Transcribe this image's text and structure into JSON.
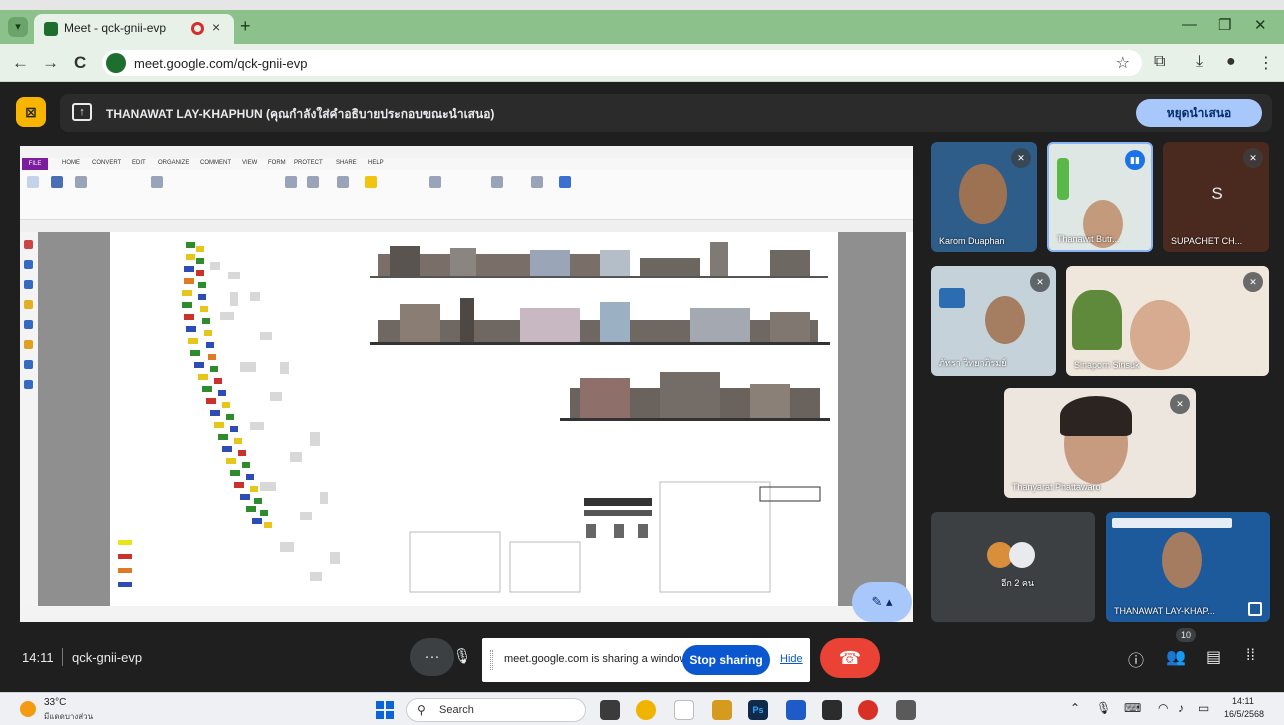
{
  "browser": {
    "tab_title": "Meet - qck-gnii-evp",
    "tab_close": "×",
    "new_tab": "+",
    "url": "meet.google.com/qck-gnii-evp",
    "nav": {
      "back": "←",
      "forward": "→",
      "reload": "C"
    },
    "window_controls": {
      "minimize": "—",
      "restore": "❐",
      "close": "✕"
    }
  },
  "presentation": {
    "banner_text": "THANAWAT LAY-KHAPHUN (คุณกำลังใส่คำอธิบายประกอบขณะนำเสนอ)",
    "stop_presenting_label": "หยุดนำเสนอ"
  },
  "shared_app": {
    "ribbon_tabs": [
      "FILE",
      "HOME",
      "CONVERT",
      "EDIT",
      "ORGANIZE",
      "COMMENT",
      "VIEW",
      "FORM",
      "PROTECT",
      "SHARE",
      "HELP"
    ]
  },
  "participants": [
    {
      "name": "Karom Duaphan",
      "muted": true
    },
    {
      "name": "Thanawit Butr...",
      "speaking": true
    },
    {
      "name": "SUPACHET CH...",
      "initial": "S",
      "muted": true
    },
    {
      "name": "ภัทรา วิทยาภิรมย์",
      "muted": true
    },
    {
      "name": "Sinaporn Sinsuk",
      "muted": true
    },
    {
      "name": "Thanyarat Phattawaro",
      "muted": true
    },
    {
      "name": "อีก 2 คน"
    },
    {
      "name": "THANAWAT LAY-KHAP..."
    }
  ],
  "controls": {
    "time": "14:11",
    "meeting_code": "qck-gnii-evp",
    "more_label": "···",
    "share_message": "meet.google.com is sharing a window.",
    "stop_sharing_label": "Stop sharing",
    "hide_label": "Hide",
    "people_count": "10"
  },
  "taskbar": {
    "temperature": "33°C",
    "weather_desc": "มีแดดบางส่วน",
    "search_label": "Search",
    "clock_time": "14:11",
    "clock_date": "16/5/2568"
  },
  "colors": {
    "meet_bg": "#1f1f1f",
    "accent_blue": "#0b57d0",
    "end_call_red": "#ea4335",
    "present_badge": "#f7b500"
  }
}
